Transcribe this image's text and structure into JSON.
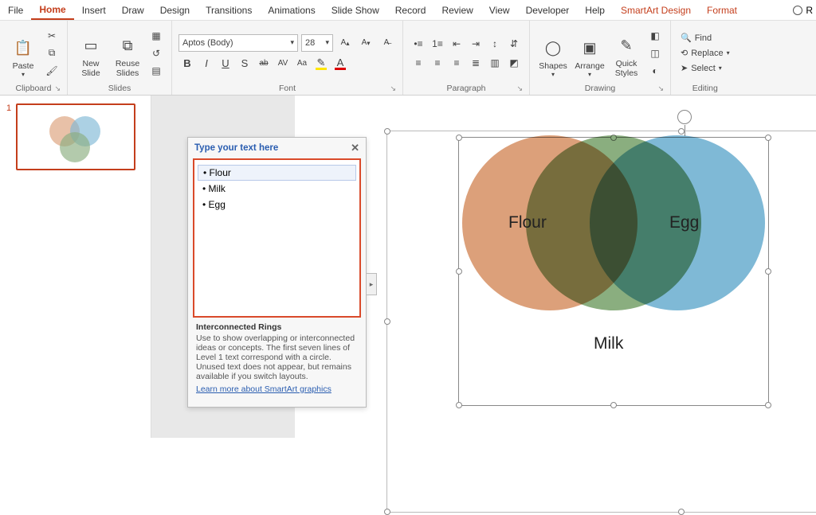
{
  "menu": {
    "tabs": [
      "File",
      "Home",
      "Insert",
      "Draw",
      "Design",
      "Transitions",
      "Animations",
      "Slide Show",
      "Record",
      "Review",
      "View",
      "Developer",
      "Help",
      "SmartArt Design",
      "Format"
    ],
    "active": "Home",
    "context_start": 13,
    "right_label": "R"
  },
  "ribbon": {
    "clipboard": {
      "paste": "Paste",
      "label": "Clipboard"
    },
    "slides": {
      "new": "New\nSlide",
      "reuse": "Reuse\nSlides",
      "label": "Slides"
    },
    "font": {
      "name": "Aptos (Body)",
      "size": "28",
      "buttons": [
        "B",
        "I",
        "U",
        "S",
        "ab",
        "AV",
        "Aa"
      ],
      "label": "Font"
    },
    "paragraph": {
      "label": "Paragraph"
    },
    "drawing": {
      "shapes": "Shapes",
      "arrange": "Arrange",
      "quick": "Quick\nStyles",
      "label": "Drawing"
    },
    "editing": {
      "find": "Find",
      "replace": "Replace",
      "select": "Select",
      "label": "Editing"
    }
  },
  "thumb": {
    "num": "1"
  },
  "textpane": {
    "header": "Type your text here",
    "items": [
      "Flour",
      "Milk",
      "Egg"
    ],
    "info_title": "Interconnected Rings",
    "info_body": "Use to show overlapping or interconnected ideas or concepts. The first seven lines of Level 1 text correspond with a circle. Unused text does not appear, but remains available if you switch layouts.",
    "link": "Learn more about SmartArt graphics"
  },
  "chart_data": {
    "type": "venn",
    "title": "Interconnected Rings",
    "sets": [
      {
        "label": "Flour",
        "color": "#dca07a"
      },
      {
        "label": "Egg",
        "color": "#7fb9d6"
      },
      {
        "label": "Milk",
        "color": "#8aae7f"
      }
    ]
  }
}
